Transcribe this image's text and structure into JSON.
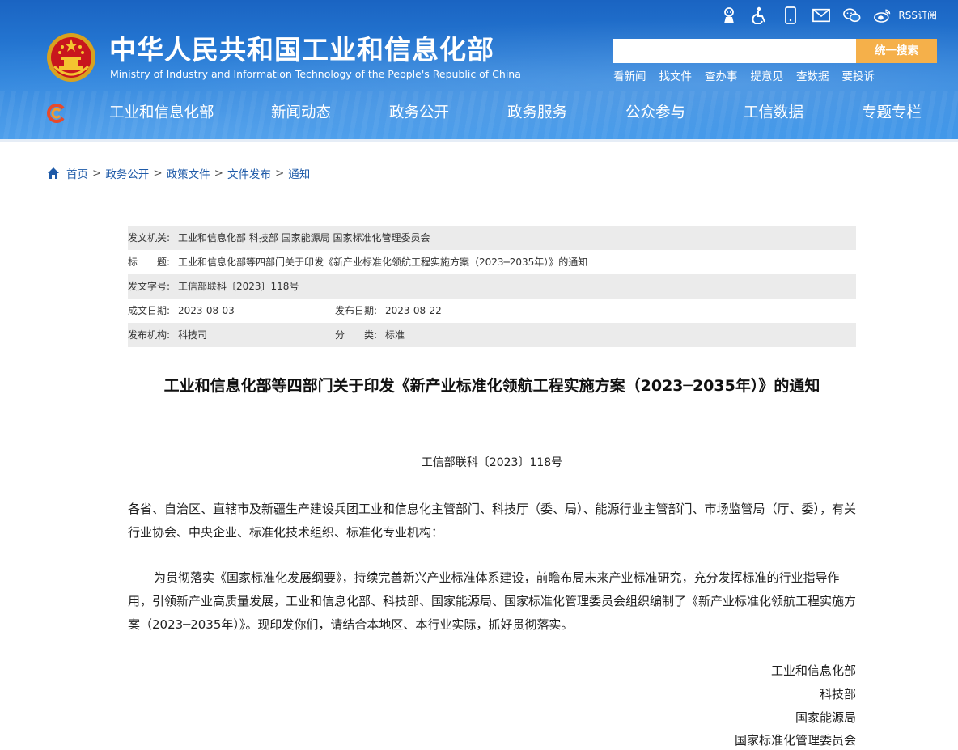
{
  "header": {
    "title_cn": "中华人民共和国工业和信息化部",
    "title_en": "Ministry of Industry and Information Technology of the People's Republic of China",
    "top_icons": [
      "robot-assistant-icon",
      "accessibility-icon",
      "mobile-phone-icon",
      "mail-icon",
      "wechat-icon",
      "weibo-icon"
    ],
    "rss_label": "RSS订阅",
    "search_placeholder": "",
    "search_button": "统一搜索",
    "quick_links": [
      "看新闻",
      "找文件",
      "查办事",
      "提意见",
      "查数据",
      "要投诉"
    ],
    "nav": [
      "工业和信息化部",
      "新闻动态",
      "政务公开",
      "政务服务",
      "公众参与",
      "工信数据",
      "专题专栏"
    ],
    "colors": {
      "header_blue": "#2b82dc",
      "search_button": "#f5b04a"
    }
  },
  "breadcrumb": [
    "首页",
    "政务公开",
    "政策文件",
    "文件发布",
    "通知"
  ],
  "info": {
    "issuer_label": "发文机关:",
    "issuer": "工业和信息化部 科技部 国家能源局 国家标准化管理委员会",
    "title_label": "标　　题:",
    "title": "工业和信息化部等四部门关于印发《新产业标准化领航工程实施方案（2023─2035年）》的通知",
    "docno_label": "发文字号:",
    "docno": "工信部联科〔2023〕118号",
    "created_label": "成文日期:",
    "created": "2023-08-03",
    "published_label": "发布日期:",
    "published": "2023-08-22",
    "org_label": "发布机构:",
    "org": "科技司",
    "category_label": "分　　类:",
    "category": "标准"
  },
  "doc": {
    "title": "工业和信息化部等四部门关于印发《新产业标准化领航工程实施方案（2023─2035年）》的通知",
    "number": "工信部联科〔2023〕118号",
    "para1": "各省、自治区、直辖市及新疆生产建设兵团工业和信息化主管部门、科技厅（委、局）、能源行业主管部门、市场监管局（厅、委），有关行业协会、中央企业、标准化技术组织、标准化专业机构：",
    "para2": "为贯彻落实《国家标准化发展纲要》，持续完善新兴产业标准体系建设，前瞻布局未来产业标准研究，充分发挥标准的行业指导作用，引领新产业高质量发展，工业和信息化部、科技部、国家能源局、国家标准化管理委员会组织编制了《新产业标准化领航工程实施方案（2023─2035年）》。现印发你们，请结合本地区、本行业实际，抓好贯彻落实。",
    "signatures": [
      "工业和信息化部",
      "科技部",
      "国家能源局",
      "国家标准化管理委员会"
    ]
  }
}
